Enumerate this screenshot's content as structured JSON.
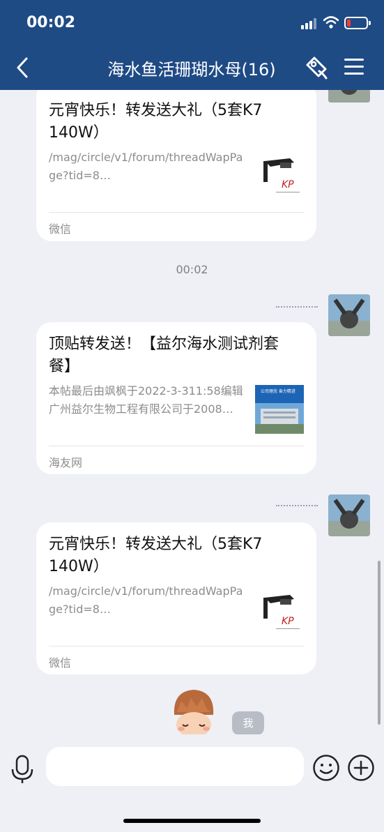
{
  "status_bar": {
    "time": "00:02"
  },
  "nav": {
    "title": "海水鱼活珊瑚水母(16)"
  },
  "messages": [
    {
      "title": "元宵快乐！转发送大礼（5套K7 140W）",
      "desc": "/mag/circle/v1/forum/threadWapPage?tid=8…",
      "source": "微信",
      "thumb_text": "KP"
    },
    {
      "title": "顶贴转发送！【益尔海水测试剂套餐】",
      "desc": "本帖最后由飒枫于2022-3-311:58编辑广州益尔生物工程有限公司于2008…",
      "source": "海友网",
      "thumb_text": "公司理念 奋力精进"
    },
    {
      "title": "元宵快乐！转发送大礼（5套K7 140W）",
      "desc": "/mag/circle/v1/forum/threadWapPage?tid=8…",
      "source": "微信",
      "thumb_text": "KP"
    }
  ],
  "time_separator": "00:02",
  "me_label": "我",
  "input": {
    "placeholder": "",
    "value": ""
  },
  "colors": {
    "nav_bg": "#1f4b85",
    "chat_bg": "#eef0f6",
    "card_bg": "#ffffff"
  }
}
